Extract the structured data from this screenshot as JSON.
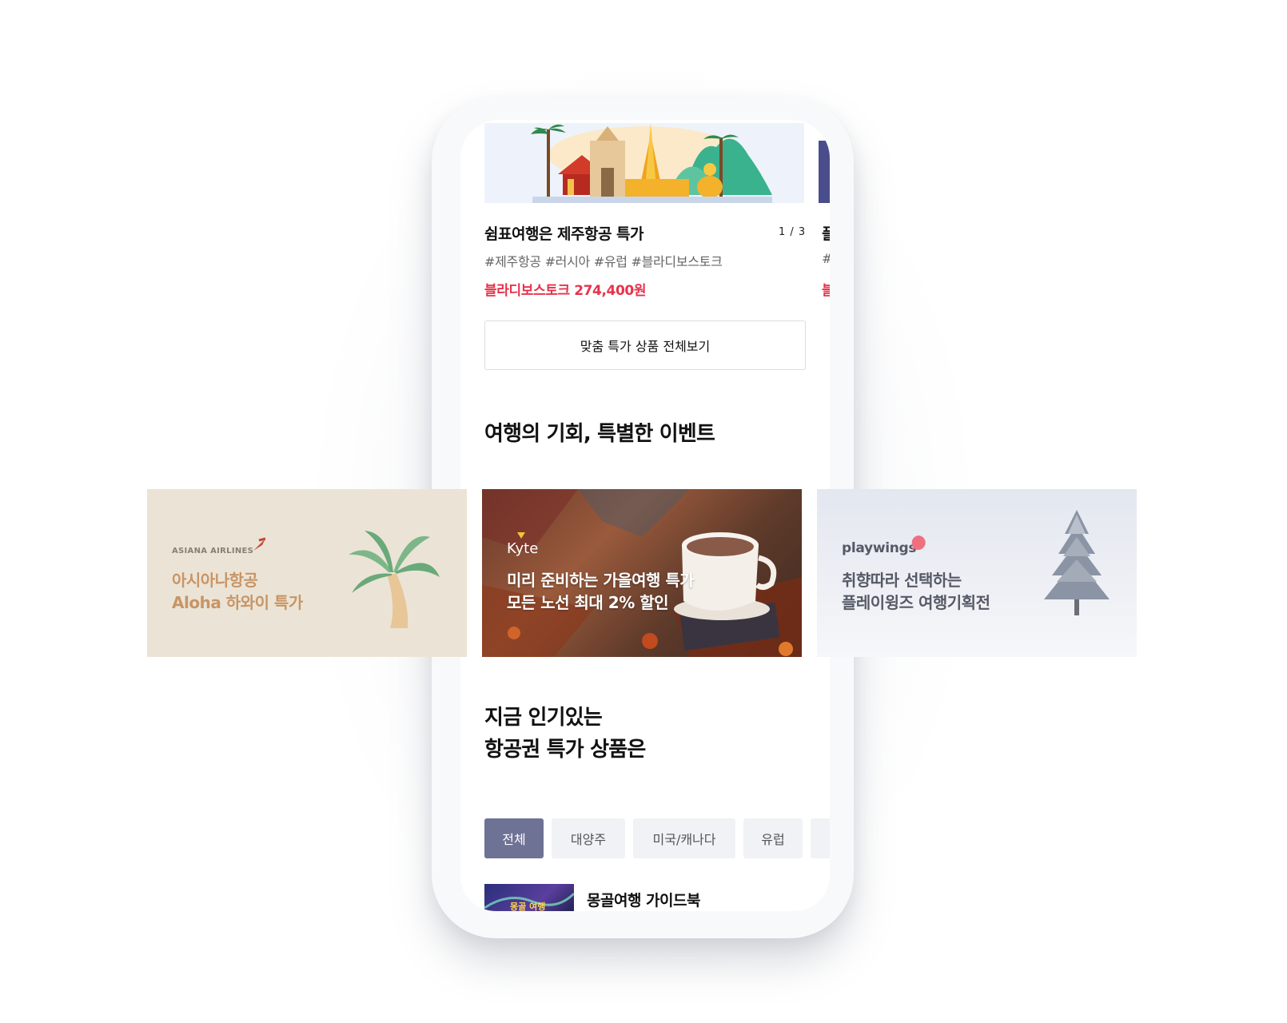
{
  "featured_card": {
    "title": "쉼표여행은 제주항공 특가",
    "pager": "1 / 3",
    "tags": "#제주항공 #러시아 #유럽 #블라디보스토크",
    "price": "블라디보스토크 274,400원"
  },
  "next_card_peek": {
    "title": "플",
    "tag": "#",
    "price": "블"
  },
  "view_all_button": "맞춤 특가 상품 전체보기",
  "events_section": {
    "title": "여행의 기회, 특별한 이벤트"
  },
  "banners": {
    "asiana": {
      "brand": "ASIANA AIRLINES",
      "line1": "아시아나항공",
      "line2": "Aloha 하와이 특가"
    },
    "kyte": {
      "brand": "Kyte",
      "line1": "미리 준비하는 가을여행 특가",
      "line2": "모든 노선 최대 2% 할인"
    },
    "playwings": {
      "brand": "playwings",
      "line1": "취향따라 선택하는",
      "line2": "플레이윙즈 여행기획전"
    }
  },
  "popular_section": {
    "title_line1": "지금 인기있는",
    "title_line2": "항공권 특가 상품은"
  },
  "tabs": [
    {
      "label": "전체",
      "active": true
    },
    {
      "label": "대양주",
      "active": false
    },
    {
      "label": "미국/캐나다",
      "active": false
    },
    {
      "label": "유럽",
      "active": false
    }
  ],
  "list_item": {
    "title": "몽골여행 가이드북",
    "thumb_text": "몽골 여행"
  },
  "colors": {
    "price_red": "#e8324b",
    "tab_active": "#6e7294",
    "asiana_text": "#c89566",
    "asiana_bg": "#ebe4d6"
  }
}
